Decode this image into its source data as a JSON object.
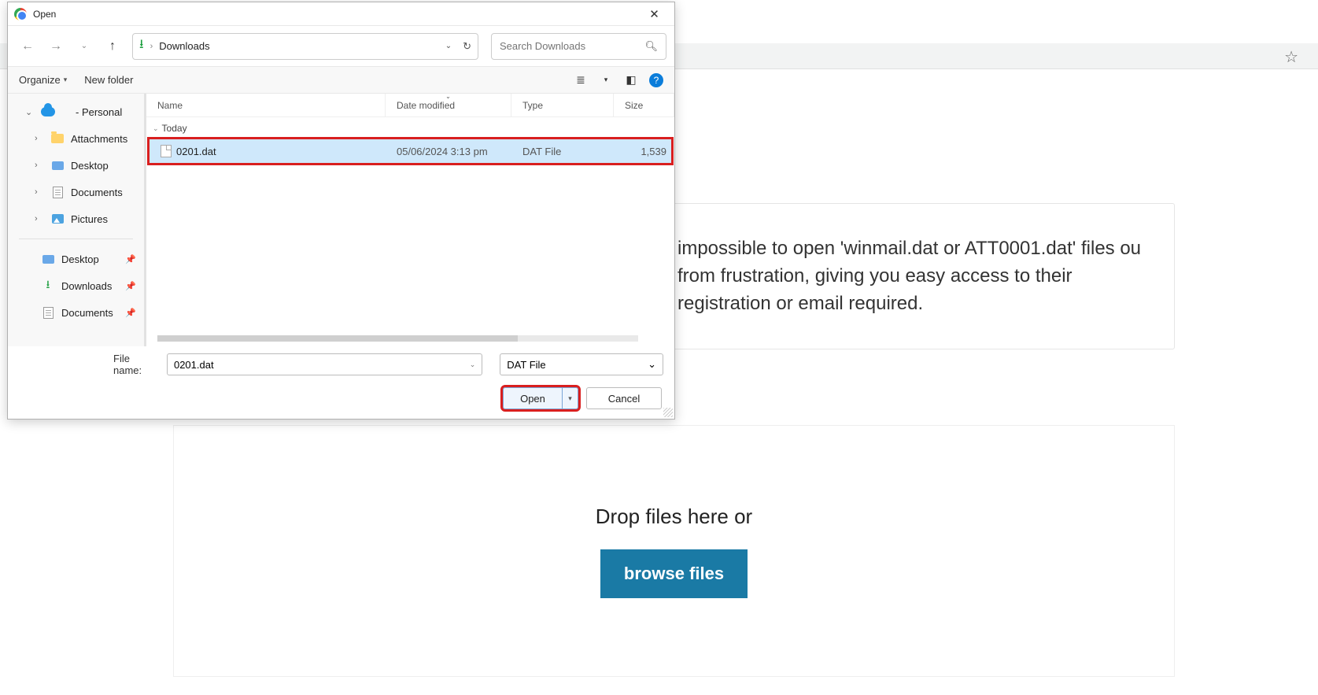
{
  "dialog": {
    "title": "Open",
    "nav": {
      "location": "Downloads",
      "search_placeholder": "Search Downloads"
    },
    "toolbar": {
      "organize": "Organize",
      "new_folder": "New folder",
      "help": "?"
    },
    "sidebar": {
      "personal": "- Personal",
      "items_top": [
        {
          "label": "Attachments",
          "icon": "folder"
        },
        {
          "label": "Desktop",
          "icon": "desktop"
        },
        {
          "label": "Documents",
          "icon": "docs"
        },
        {
          "label": "Pictures",
          "icon": "pics"
        }
      ],
      "items_quick": [
        {
          "label": "Desktop",
          "icon": "desktop"
        },
        {
          "label": "Downloads",
          "icon": "dl"
        },
        {
          "label": "Documents",
          "icon": "docs"
        }
      ]
    },
    "columns": {
      "name": "Name",
      "date": "Date modified",
      "type": "Type",
      "size": "Size"
    },
    "group": "Today",
    "file": {
      "name": "0201.dat",
      "date": "05/06/2024 3:13 pm",
      "type": "DAT File",
      "size": "1,539"
    },
    "footer": {
      "file_name_label": "File name:",
      "file_name_value": "0201.dat",
      "filter": "DAT File",
      "open": "Open",
      "cancel": "Cancel"
    }
  },
  "bg": {
    "para": "impossible to open 'winmail.dat or ATT0001.dat' files ou from frustration, giving you easy access to their registration or email required.",
    "drop": "Drop files here or",
    "browse": "browse files"
  }
}
